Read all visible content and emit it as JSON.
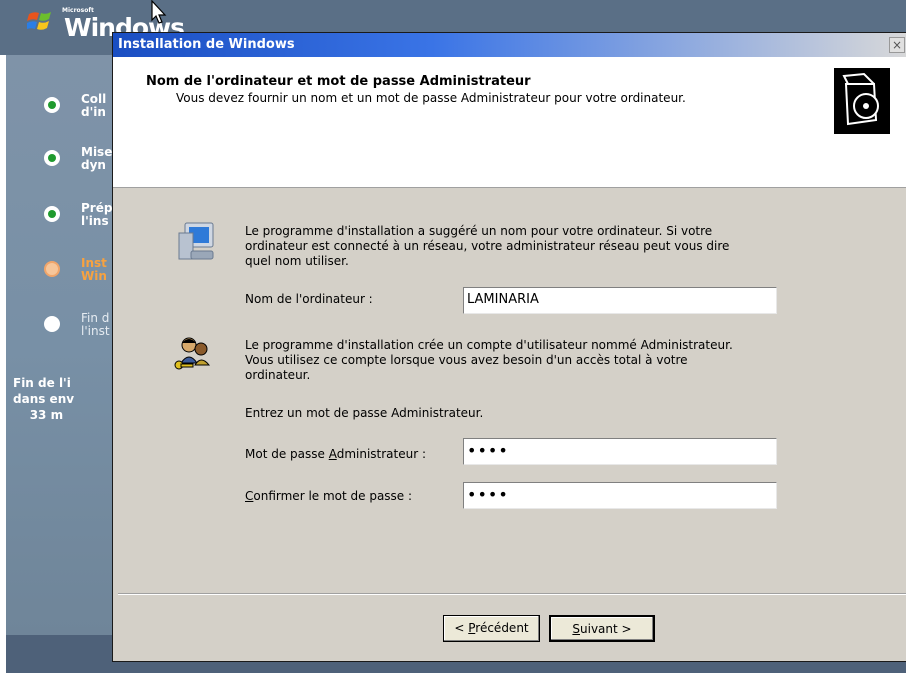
{
  "setup": {
    "logo_microsoft": "Microsoft",
    "logo_windows": "Windows",
    "steps": [
      {
        "label": "Coll\nd'in",
        "state": "done"
      },
      {
        "label": "Mise\ndyn",
        "state": "done"
      },
      {
        "label": "Prép\nl'ins",
        "state": "done"
      },
      {
        "label": "Inst\nWin",
        "state": "current"
      },
      {
        "label": "Fin d\nl'inst",
        "state": "pending"
      }
    ],
    "remaining": "Fin de l'i\ndans env\n    33 m"
  },
  "dialog": {
    "title": "Installation de Windows",
    "close_glyph": "×",
    "header_title": "Nom de l'ordinateur et mot de passe Administrateur",
    "header_subtitle": "Vous devez fournir un nom et un mot de passe Administrateur pour votre ordinateur.",
    "computer_paragraph": "Le programme d'installation a suggéré un nom pour votre ordinateur. Si votre\nordinateur est connecté à un réseau, votre administrateur réseau peut vous dire\nquel nom utiliser.",
    "computer_name": {
      "label": "Nom de l'ordinateur :",
      "value": "LAMINARIA"
    },
    "admin_paragraph": "Le programme d'installation crée un compte d'utilisateur nommé Administrateur.\nVous utilisez ce compte lorsque vous avez besoin d'un accès total à votre\nordinateur.",
    "enter_password_text": "Entrez un mot de passe Administrateur.",
    "admin_password": {
      "label_prefix": "Mot de passe ",
      "label_accel": "A",
      "label_suffix": "dministrateur :",
      "value": "••••"
    },
    "confirm_password": {
      "label_accel": "C",
      "label_suffix": "onfirmer le mot de passe :",
      "value": "••••"
    },
    "buttons": {
      "prev_prefix": "< ",
      "prev_accel": "P",
      "prev_suffix": "récédent",
      "next_accel": "S",
      "next_suffix": "uivant >"
    }
  },
  "icons": {
    "windows_flag": "windows-flag-icon",
    "cursor": "mouse-pointer-icon",
    "setup_disc": "setup-disc-icon",
    "computer": "computer-icon",
    "users": "users-keys-icon"
  },
  "colors": {
    "title_bar_start": "#1a4ec2",
    "dialog_bg": "#d4d0c8",
    "current_step": "#f7a23f",
    "done_step_dot": "#1f9a2e"
  }
}
